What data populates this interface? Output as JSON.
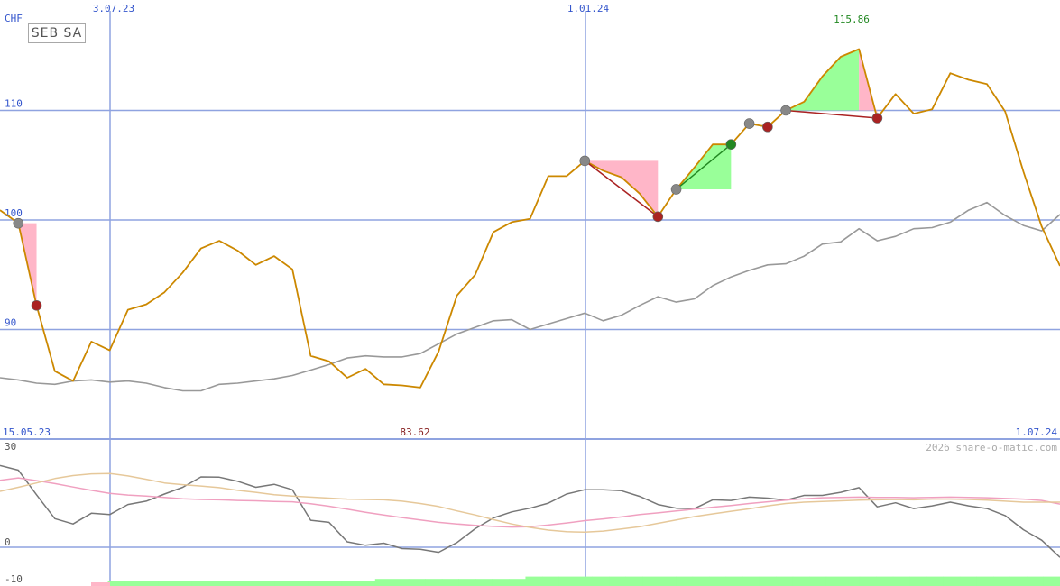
{
  "stock_name": "SEB SA",
  "currency": "CHF",
  "copyright": "2026 share-o-matic.com",
  "colors": {
    "price": "#cc8800",
    "moving_average": "#999999",
    "grid": "#8fa3e0",
    "axis_text": "#3355cc",
    "buy_fill": "#99ff99",
    "sell_fill": "#ffb6c8",
    "buy_marker": "#228822",
    "sell_marker": "#aa2222",
    "neutral_marker": "#888888"
  },
  "chart_data": [
    {
      "type": "line",
      "panel": "price",
      "y_gridlines": [
        90,
        100,
        110
      ],
      "ylim": [
        83.62,
        115.86
      ],
      "x_tick_labels": [
        "15.05.23",
        "3.07.23",
        "1.01.24",
        "1.07.24"
      ],
      "min_label": "83.62",
      "max_label": "115.86",
      "series": [
        {
          "values": [
            100.9,
            99.7,
            92.2,
            86.2,
            85.3,
            88.9,
            88.1,
            91.8,
            92.3,
            93.4,
            95.2,
            97.4,
            98.1,
            97.2,
            95.9,
            96.7,
            95.5,
            87.6,
            87.1,
            85.6,
            86.4,
            85.0,
            84.9,
            84.7,
            88.0,
            93.1,
            95.0,
            98.9,
            99.8,
            100.1,
            104.0,
            104.0,
            105.4,
            104.5,
            103.9,
            102.4,
            100.3,
            102.8,
            104.8,
            106.9,
            106.9,
            108.8,
            108.5,
            110.0,
            110.8,
            113.1,
            114.9,
            115.6,
            109.3,
            111.5,
            109.7,
            110.1,
            113.4,
            112.8,
            112.4,
            109.9,
            104.4,
            99.4,
            95.8
          ]
        },
        {
          "values": [
            85.6,
            85.4,
            85.1,
            85.0,
            85.3,
            85.4,
            85.2,
            85.3,
            85.1,
            84.7,
            84.4,
            84.4,
            85.0,
            85.1,
            85.3,
            85.5,
            85.8,
            86.3,
            86.8,
            87.4,
            87.6,
            87.5,
            87.5,
            87.8,
            88.7,
            89.6,
            90.2,
            90.8,
            90.9,
            90.0,
            90.5,
            91.0,
            91.5,
            90.8,
            91.3,
            92.2,
            93.0,
            92.5,
            92.8,
            94.0,
            94.8,
            95.4,
            95.9,
            96.0,
            96.7,
            97.8,
            98.0,
            99.2,
            98.1,
            98.5,
            99.2,
            99.3,
            99.8,
            100.9,
            101.6,
            100.4,
            99.5,
            99.0,
            100.5
          ]
        }
      ]
    },
    {
      "type": "line",
      "panel": "indicator",
      "y_tick_labels": [
        "30",
        "0",
        "-10"
      ],
      "ylim": [
        -10,
        30
      ],
      "series": [
        {
          "values": [
            24.3,
            22.9,
            15.6,
            8.5,
            6.9,
            10.1,
            9.7,
            12.7,
            13.7,
            15.8,
            17.8,
            20.9,
            20.8,
            19.6,
            17.8,
            18.7,
            17.1,
            8.0,
            7.4,
            1.6,
            0.6,
            1.2,
            -0.4,
            -0.6,
            -1.5,
            1.4,
            5.5,
            8.7,
            10.5,
            11.6,
            13.1,
            15.8,
            17.1,
            17.1,
            16.8,
            15.1,
            12.7,
            11.6,
            11.5,
            14.1,
            13.9,
            14.9,
            14.6,
            14.0,
            15.4,
            15.4,
            16.3,
            17.7,
            12.0,
            13.2,
            11.5,
            12.3,
            13.4,
            12.3,
            11.5,
            9.4,
            5.2,
            2.1,
            -3.0
          ]
        },
        {
          "values": [
            19.9,
            20.6,
            19.8,
            18.9,
            17.9,
            16.9,
            16.0,
            15.5,
            15.2,
            14.8,
            14.4,
            14.2,
            14.1,
            13.9,
            13.8,
            13.6,
            13.5,
            12.9,
            12.2,
            11.3,
            10.4,
            9.6,
            8.8,
            8.1,
            7.4,
            6.9,
            6.5,
            6.2,
            6.0,
            6.1,
            6.6,
            7.2,
            7.9,
            8.4,
            9.0,
            9.7,
            10.2,
            10.8,
            11.3,
            11.9,
            12.4,
            13.0,
            13.5,
            14.0,
            14.4,
            14.7,
            14.8,
            14.9,
            14.8,
            14.8,
            14.7,
            14.8,
            14.9,
            14.8,
            14.7,
            14.5,
            14.3,
            13.9,
            12.8
          ]
        },
        {
          "values": [
            16.6,
            17.8,
            19.1,
            20.4,
            21.3,
            21.8,
            21.9,
            21.2,
            20.2,
            19.1,
            18.6,
            18.2,
            17.7,
            16.9,
            16.3,
            15.6,
            15.2,
            14.9,
            14.6,
            14.3,
            14.2,
            14.1,
            13.7,
            13.0,
            12.1,
            10.8,
            9.6,
            8.2,
            6.9,
            5.9,
            5.1,
            4.6,
            4.5,
            4.8,
            5.4,
            6.1,
            7.1,
            8.1,
            9.1,
            9.9,
            10.7,
            11.4,
            12.3,
            13.0,
            13.4,
            13.6,
            13.8,
            14.0,
            14.1,
            14.2,
            14.1,
            14.3,
            14.3,
            14.2,
            14.0,
            13.7,
            13.4,
            13.4,
            13.4
          ]
        }
      ],
      "bars": [
        1,
        2,
        2,
        2,
        2,
        2,
        2,
        2,
        2,
        2,
        2,
        2,
        2,
        2,
        2,
        2,
        2,
        3,
        3,
        3,
        3,
        3,
        3,
        3,
        3,
        3,
        4,
        4,
        4,
        4,
        4,
        4,
        4,
        4,
        4,
        4,
        4,
        4,
        4,
        4,
        4,
        4,
        4,
        4,
        4,
        4,
        4,
        4,
        4,
        4,
        4,
        4,
        4,
        4,
        4,
        4,
        4,
        4
      ]
    }
  ]
}
